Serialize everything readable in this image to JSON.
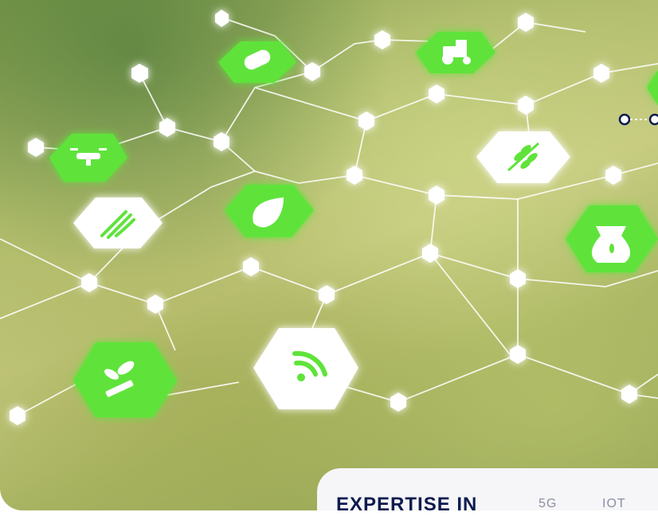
{
  "hero": {
    "icons": [
      "drone-icon",
      "pill-capsule-icon",
      "tractor-icon",
      "wheat-icon",
      "wireless-signal-icon",
      "water-drop-icon",
      "grain-sack-icon",
      "plant-sprout-icon",
      "wifi-icon"
    ]
  },
  "footer": {
    "expertise_label": "EXPERTISE IN",
    "tags": [
      "5G",
      "IOT"
    ]
  },
  "colors": {
    "accent_green": "#5fe33a",
    "navy": "#0d1b4f",
    "muted_gray": "#8a8fa3"
  }
}
